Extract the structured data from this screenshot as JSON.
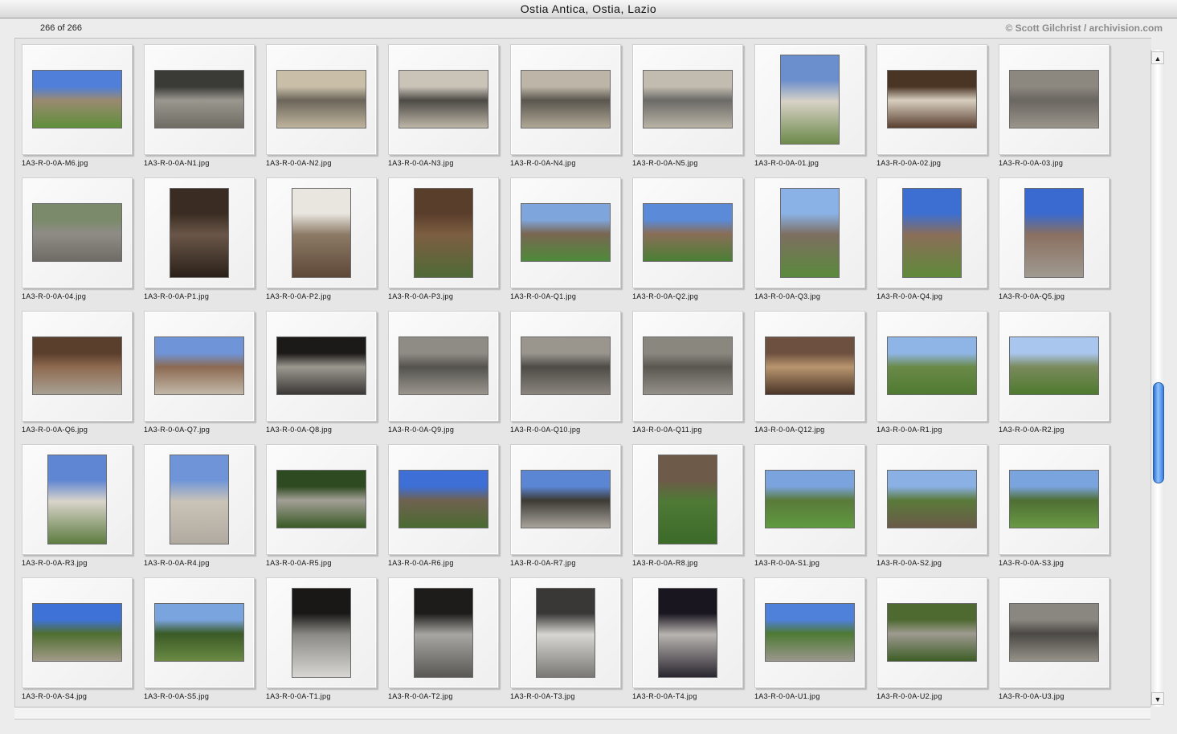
{
  "window": {
    "title": "Ostia Antica, Ostia, Lazio"
  },
  "header": {
    "count": "266 of 266",
    "copyright": "© Scott Gilchrist / archivision.com"
  },
  "items": [
    {
      "name": "1A3-R-0-0A-M6.jpg",
      "orientation": "land",
      "colors": [
        "#4f7fd8",
        "#9a8a70",
        "#5f8f3a"
      ]
    },
    {
      "name": "1A3-R-0-0A-N1.jpg",
      "orientation": "land",
      "colors": [
        "#3a3a36",
        "#9a978f",
        "#6f6c64"
      ]
    },
    {
      "name": "1A3-R-0-0A-N2.jpg",
      "orientation": "land",
      "colors": [
        "#c9bfa9",
        "#6b655a",
        "#bfb49d"
      ]
    },
    {
      "name": "1A3-R-0-0A-N3.jpg",
      "orientation": "land",
      "colors": [
        "#c9c3b8",
        "#4d4a45",
        "#bdb6a8"
      ]
    },
    {
      "name": "1A3-R-0-0A-N4.jpg",
      "orientation": "land",
      "colors": [
        "#bdb6a8",
        "#5a564e",
        "#b0a896"
      ]
    },
    {
      "name": "1A3-R-0-0A-N5.jpg",
      "orientation": "land",
      "colors": [
        "#c2bcb0",
        "#6b6a66",
        "#b9b3a6"
      ]
    },
    {
      "name": "1A3-R-0-0A-01.jpg",
      "orientation": "port",
      "colors": [
        "#6b8fcc",
        "#d8d2c6",
        "#6d8a4b"
      ]
    },
    {
      "name": "1A3-R-0-0A-02.jpg",
      "orientation": "land",
      "colors": [
        "#4a3424",
        "#d8cfc0",
        "#5a4030"
      ]
    },
    {
      "name": "1A3-R-0-0A-03.jpg",
      "orientation": "land",
      "colors": [
        "#8c8880",
        "#6a6660",
        "#9a958b"
      ]
    },
    {
      "name": "1A3-R-0-0A-04.jpg",
      "orientation": "land",
      "colors": [
        "#7a8a6a",
        "#8f8c86",
        "#6f6c66"
      ]
    },
    {
      "name": "1A3-R-0-0A-P1.jpg",
      "orientation": "port",
      "colors": [
        "#3a2c22",
        "#6a5648",
        "#2a2019"
      ]
    },
    {
      "name": "1A3-R-0-0A-P2.jpg",
      "orientation": "port",
      "colors": [
        "#e9e6e0",
        "#8c7a66",
        "#5e4838"
      ]
    },
    {
      "name": "1A3-R-0-0A-P3.jpg",
      "orientation": "port",
      "colors": [
        "#5a3e2c",
        "#7d5e42",
        "#4f6a36"
      ]
    },
    {
      "name": "1A3-R-0-0A-Q1.jpg",
      "orientation": "land",
      "colors": [
        "#7fa6dc",
        "#7a6652",
        "#4e8a3a"
      ]
    },
    {
      "name": "1A3-R-0-0A-Q2.jpg",
      "orientation": "land",
      "colors": [
        "#5a8ad8",
        "#8a6e58",
        "#4a7f34"
      ]
    },
    {
      "name": "1A3-R-0-0A-Q3.jpg",
      "orientation": "port",
      "colors": [
        "#8ab2e6",
        "#7d6e60",
        "#5a8a3c"
      ]
    },
    {
      "name": "1A3-R-0-0A-Q4.jpg",
      "orientation": "port",
      "colors": [
        "#3d6fd2",
        "#8a6e58",
        "#5f8a3a"
      ]
    },
    {
      "name": "1A3-R-0-0A-Q5.jpg",
      "orientation": "port",
      "colors": [
        "#3a6ad0",
        "#8a7060",
        "#a09a90"
      ]
    },
    {
      "name": "1A3-R-0-0A-Q6.jpg",
      "orientation": "land",
      "colors": [
        "#5a3f2c",
        "#8e6a50",
        "#a8a194"
      ]
    },
    {
      "name": "1A3-R-0-0A-Q7.jpg",
      "orientation": "land",
      "colors": [
        "#6f94d8",
        "#8c6a52",
        "#c2b8a8"
      ]
    },
    {
      "name": "1A3-R-0-0A-Q8.jpg",
      "orientation": "land",
      "colors": [
        "#1c1a18",
        "#9b9890",
        "#3a3835"
      ]
    },
    {
      "name": "1A3-R-0-0A-Q9.jpg",
      "orientation": "land",
      "colors": [
        "#8f8c86",
        "#55534e",
        "#9a968e"
      ]
    },
    {
      "name": "1A3-R-0-0A-Q10.jpg",
      "orientation": "land",
      "colors": [
        "#9a968e",
        "#4e4b47",
        "#8a867e"
      ]
    },
    {
      "name": "1A3-R-0-0A-Q11.jpg",
      "orientation": "land",
      "colors": [
        "#8a877f",
        "#5a5750",
        "#95918a"
      ]
    },
    {
      "name": "1A3-R-0-0A-Q12.jpg",
      "orientation": "land",
      "colors": [
        "#6e5040",
        "#b8956e",
        "#4a3528"
      ]
    },
    {
      "name": "1A3-R-0-0A-R1.jpg",
      "orientation": "land",
      "colors": [
        "#8fb5e6",
        "#6a8a48",
        "#4f7a30"
      ]
    },
    {
      "name": "1A3-R-0-0A-R2.jpg",
      "orientation": "land",
      "colors": [
        "#a9c6ee",
        "#7a8a5c",
        "#4e7a2e"
      ]
    },
    {
      "name": "1A3-R-0-0A-R3.jpg",
      "orientation": "port",
      "colors": [
        "#5f86d2",
        "#d8d4ca",
        "#5d7c40"
      ]
    },
    {
      "name": "1A3-R-0-0A-R4.jpg",
      "orientation": "port",
      "colors": [
        "#6f95d8",
        "#c9c3b8",
        "#b0aaa0"
      ]
    },
    {
      "name": "1A3-R-0-0A-R5.jpg",
      "orientation": "land",
      "colors": [
        "#2e4a20",
        "#a39f96",
        "#3a5a26"
      ]
    },
    {
      "name": "1A3-R-0-0A-R6.jpg",
      "orientation": "land",
      "colors": [
        "#3d6fd6",
        "#6f6250",
        "#4a6a30"
      ]
    },
    {
      "name": "1A3-R-0-0A-R7.jpg",
      "orientation": "land",
      "colors": [
        "#5a86d4",
        "#3d3a34",
        "#a8a49c"
      ]
    },
    {
      "name": "1A3-R-0-0A-R8.jpg",
      "orientation": "port",
      "colors": [
        "#6e5a48",
        "#4e7a36",
        "#3c6a28"
      ]
    },
    {
      "name": "1A3-R-0-0A-S1.jpg",
      "orientation": "land",
      "colors": [
        "#7ba3de",
        "#5a7a3a",
        "#5f9a40"
      ]
    },
    {
      "name": "1A3-R-0-0A-S2.jpg",
      "orientation": "land",
      "colors": [
        "#8ab0e4",
        "#5a7a3a",
        "#6a5a48"
      ]
    },
    {
      "name": "1A3-R-0-0A-S3.jpg",
      "orientation": "land",
      "colors": [
        "#7aa4de",
        "#4e6e34",
        "#6a9a44"
      ]
    },
    {
      "name": "1A3-R-0-0A-S4.jpg",
      "orientation": "land",
      "colors": [
        "#3f72d6",
        "#4e6e30",
        "#a29a88"
      ]
    },
    {
      "name": "1A3-R-0-0A-S5.jpg",
      "orientation": "land",
      "colors": [
        "#7aa4de",
        "#3a5a26",
        "#6a8a44"
      ]
    },
    {
      "name": "1A3-R-0-0A-T1.jpg",
      "orientation": "port",
      "colors": [
        "#1a1816",
        "#8c8a86",
        "#d8d6d2"
      ]
    },
    {
      "name": "1A3-R-0-0A-T2.jpg",
      "orientation": "port",
      "colors": [
        "#1e1c1a",
        "#a8a6a2",
        "#5a5854"
      ]
    },
    {
      "name": "1A3-R-0-0A-T3.jpg",
      "orientation": "port",
      "colors": [
        "#3a3836",
        "#d8d6d2",
        "#7a7874"
      ]
    },
    {
      "name": "1A3-R-0-0A-T4.jpg",
      "orientation": "port",
      "colors": [
        "#1a1620",
        "#b8b4b0",
        "#2a2630"
      ]
    },
    {
      "name": "1A3-R-0-0A-U1.jpg",
      "orientation": "land",
      "colors": [
        "#4f80da",
        "#4e7a34",
        "#9a968c"
      ]
    },
    {
      "name": "1A3-R-0-0A-U2.jpg",
      "orientation": "land",
      "colors": [
        "#4e6a30",
        "#9e9a90",
        "#3e5e26"
      ]
    },
    {
      "name": "1A3-R-0-0A-U3.jpg",
      "orientation": "land",
      "colors": [
        "#8a8780",
        "#4a4844",
        "#969289"
      ]
    }
  ]
}
